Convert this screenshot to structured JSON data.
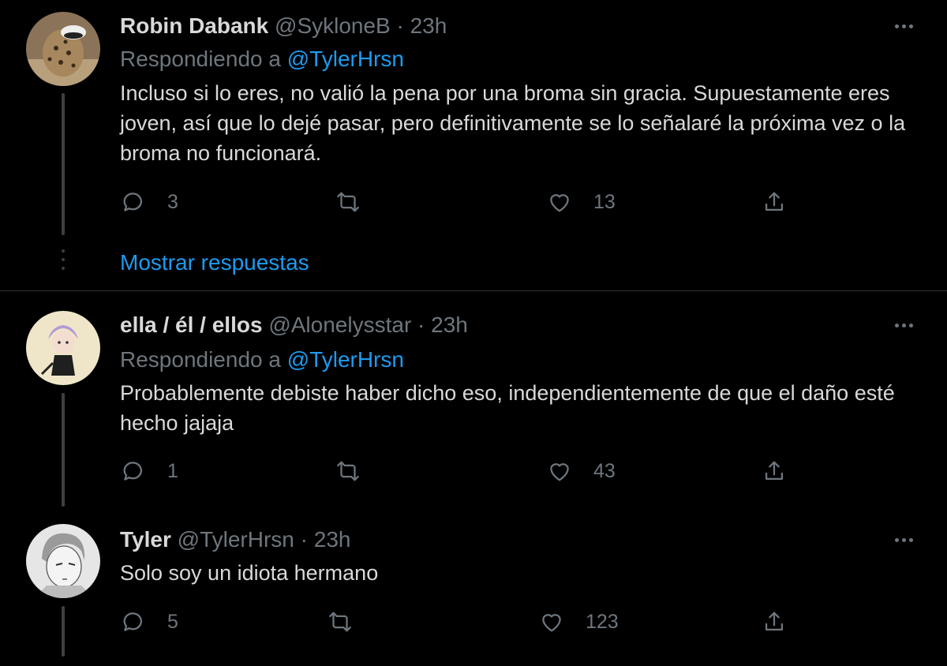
{
  "tweets": [
    {
      "name": "Robin Dabank",
      "meta": "@SykloneB · 23h",
      "replying_prefix": "Respondiendo a",
      "replying_to": "@TylerHrsn",
      "text": "Incluso si lo eres, no valió la pena por una broma sin gracia. Supuestamente eres joven, así que lo dejé pasar, pero definitivamente se lo señalaré la próxima vez o la broma no funcionará.",
      "replies": "3",
      "retweets": "",
      "likes": "13"
    },
    {
      "name": "ella / él / ellos",
      "meta": "@Alonelysstar · 23h",
      "replying_prefix": "Respondiendo a",
      "replying_to": "@TylerHrsn",
      "text": "Probablemente debiste haber dicho eso, independientemente de que el daño esté hecho jajaja",
      "replies": "1",
      "retweets": "",
      "likes": "43"
    },
    {
      "name": "Tyler",
      "meta": "@TylerHrsn · 23h",
      "text": "Solo soy un idiota hermano",
      "replies": "5",
      "retweets": "",
      "likes": "123"
    }
  ],
  "show_replies_label": "Mostrar respuestas",
  "icons": {
    "reply": "reply-icon",
    "retweet": "retweet-icon",
    "like": "heart-icon",
    "share": "share-icon",
    "more": "more-icon"
  },
  "colors": {
    "background": "#000000",
    "text": "#d9d9d9",
    "muted": "#6e767d",
    "accent": "#1d9bf0"
  }
}
